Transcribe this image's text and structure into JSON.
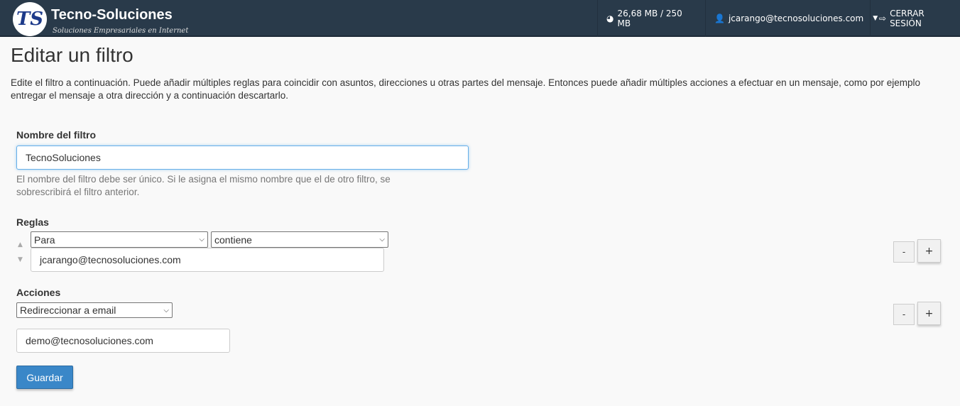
{
  "header": {
    "logo_letters": "TS",
    "brand": "Tecno-Soluciones",
    "tagline": "Soluciones Empresariales en Internet",
    "disk_usage": "26,68 MB / 250 MB",
    "user": "jcarango@tecnosoluciones.com",
    "logout": "CERRAR SESIÓN"
  },
  "page": {
    "title": "Editar un filtro",
    "description": "Edite el filtro a continuación. Puede añadir múltiples reglas para coincidir con asuntos, direcciones u otras partes del mensaje. Entonces puede añadir múltiples acciones a efectuar en un mensaje, como por ejemplo entregar el mensaje a otra dirección y a continuación descartarlo."
  },
  "form": {
    "name_label": "Nombre del filtro",
    "name_value": "TecnoSoluciones",
    "name_help": "El nombre del filtro debe ser único. Si le asigna el mismo nombre que el de otro filtro, se sobrescribirá el filtro anterior.",
    "rules_label": "Reglas",
    "rule_field": "Para",
    "rule_operator": "contiene",
    "rule_value": "jcarango@tecnosoluciones.com",
    "actions_label": "Acciones",
    "action_type": "Redireccionar a email",
    "action_value": "demo@tecnosoluciones.com",
    "minus": "-",
    "plus": "+",
    "save": "Guardar"
  }
}
